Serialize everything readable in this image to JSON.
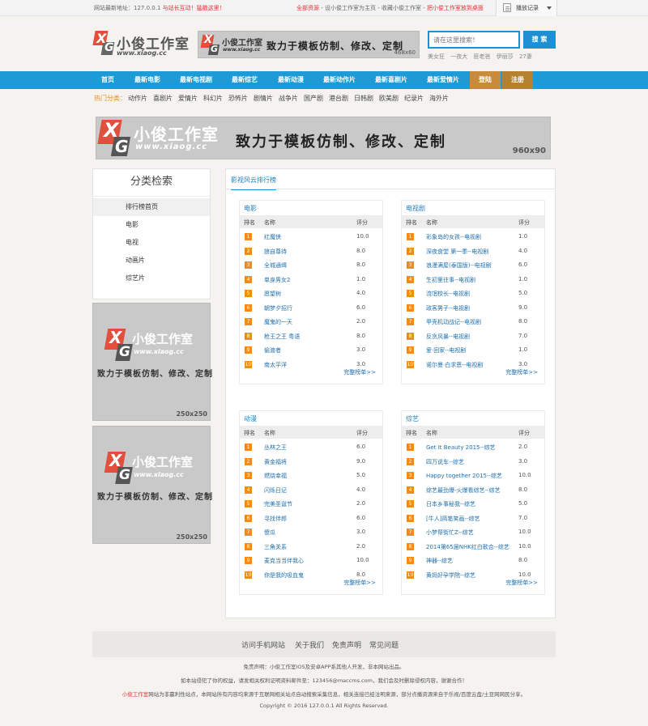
{
  "topbar": {
    "site_addr_label": "网站最新地址：127.0.0.1",
    "site_addr_note": " 与站长互动！猛戳这里！",
    "all_resources": "全部资源",
    "set_home": " - 设小俊工作室为主页 - 收藏小俊工作室 - ",
    "desktop_link": "把小俊工作室放到桌面",
    "history_label": "播放记录"
  },
  "header": {
    "logo_name": "小俊工作室",
    "logo_url": "www.xiaog.cc",
    "banner_name": "小俊工作室",
    "banner_url": "www.xiaog.cc",
    "banner_slogan": "致力于模板仿制、修改、定制",
    "banner_size": "468x60",
    "search_placeholder": "请在这里搜索！",
    "search_button": "搜 索",
    "hot_words": [
      "美女狂",
      "一夜大",
      "匪老爸",
      "伊丽莎",
      "27妻"
    ]
  },
  "nav": {
    "items": [
      "首页",
      "最新电影",
      "最新电视剧",
      "最新综艺",
      "最新动漫",
      "最新动作片",
      "最新喜剧片",
      "最新爱情片"
    ],
    "login": "登陆",
    "register": "注册"
  },
  "categories": {
    "label": "热门分类：",
    "items": [
      "动作片",
      "喜剧片",
      "爱情片",
      "科幻片",
      "恐怖片",
      "剧情片",
      "战争片",
      "国产剧",
      "港台剧",
      "日韩剧",
      "欧美剧",
      "纪录片",
      "海外片"
    ]
  },
  "big_banner": {
    "name": "小俊工作室",
    "url": "www.xiaog.cc",
    "slogan": "致力于模板仿制、修改、定制",
    "size": "960x90"
  },
  "sidebar": {
    "title": "分类检索",
    "items": [
      "排行榜首页",
      "电影",
      "电视",
      "动画片",
      "综艺片"
    ],
    "ad_name": "小俊工作室",
    "ad_url": "www.xiaog.cc",
    "ad_slogan": "致力于模板仿制、修改、定制",
    "ad_size": "250x250"
  },
  "main": {
    "tab": "影视风云排行榜",
    "col_rank": "排名",
    "col_name": "名称",
    "col_score": "评分",
    "more": "完整榜单>>",
    "movie": {
      "title": "电影",
      "rows": [
        {
          "name": "红魔侠",
          "score": "10.0"
        },
        {
          "name": "狼自尊待",
          "score": "8.0"
        },
        {
          "name": "全城通缉",
          "score": "8.0"
        },
        {
          "name": "单身男女2",
          "score": "1.0"
        },
        {
          "name": "愿望树",
          "score": "4.0"
        },
        {
          "name": "朝梦夕招行",
          "score": "6.0"
        },
        {
          "name": "魔鬼的一天",
          "score": "2.0"
        },
        {
          "name": "枪王之王 粤语",
          "score": "8.0"
        },
        {
          "name": "偷渡者",
          "score": "3.0"
        },
        {
          "name": "南太平洋",
          "score": "3.0"
        }
      ]
    },
    "tv": {
      "title": "电视剧",
      "rows": [
        {
          "name": "彩象岛的女孩--电视剧",
          "score": "1.0"
        },
        {
          "name": "深夜食堂 第一季--电视剧",
          "score": "4.0"
        },
        {
          "name": "浪漫满屋(泰国版)--电视剧",
          "score": "6.0"
        },
        {
          "name": "生初里往事--电视剧",
          "score": "1.0"
        },
        {
          "name": "流氓校长--电视剧",
          "score": "5.0"
        },
        {
          "name": "政客男子--电视剧",
          "score": "9.0"
        },
        {
          "name": "甲壳机动战记--电视剧",
          "score": "8.0"
        },
        {
          "name": "反贪风暴--电视剧",
          "score": "7.0"
        },
        {
          "name": "爱·回家--电视剧",
          "score": "1.0"
        },
        {
          "name": "诺尔曼·白求恩--电视剧",
          "score": "3.0"
        }
      ]
    },
    "anime": {
      "title": "动漫",
      "rows": [
        {
          "name": "丛林之王",
          "score": "6.0"
        },
        {
          "name": "黄金福将",
          "score": "9.0"
        },
        {
          "name": "燃烧幸福",
          "score": "5.0"
        },
        {
          "name": "闪烁日记",
          "score": "4.0"
        },
        {
          "name": "完美圣诞节",
          "score": "2.0"
        },
        {
          "name": "寻找伴郎",
          "score": "6.0"
        },
        {
          "name": "傻瓜",
          "score": "3.0"
        },
        {
          "name": "三角关系",
          "score": "2.0"
        },
        {
          "name": "麦克当当伴我心",
          "score": "10.0"
        },
        {
          "name": "你是我的吸血鬼",
          "score": "8.0"
        }
      ]
    },
    "variety": {
      "title": "综艺",
      "rows": [
        {
          "name": "Get It Beauty 2015--综艺",
          "score": "2.0"
        },
        {
          "name": "四万说车--综艺",
          "score": "3.0"
        },
        {
          "name": "Happy together 2015--综艺",
          "score": "10.0"
        },
        {
          "name": "综艺最劲爆-火爆看综艺--综艺",
          "score": "8.0"
        },
        {
          "name": "日本乡事秘我--综艺",
          "score": "5.0"
        },
        {
          "name": "[牛人]简笔笑画--综艺",
          "score": "7.0"
        },
        {
          "name": "小梦帮街忙Z--综艺",
          "score": "10.0"
        },
        {
          "name": "2014第65届NHK红白歌合--综艺",
          "score": "10.0"
        },
        {
          "name": "神器--综艺",
          "score": "8.0"
        },
        {
          "name": "黄妈好孕学院--综艺",
          "score": "10.0"
        }
      ]
    }
  },
  "footer": {
    "links": [
      "访问手机网站",
      "关于我们",
      "免责声明",
      "常见问题"
    ],
    "line1": "免责声明：小俊工作室IOS及安卓APP系其他人开发，非本网站出品。",
    "line2": "如本站侵犯了你的权益，请发相关权利证明资料邮件至：123456@maccms.com，我们会及时删除侵权内容，谢谢合作！",
    "line3_red": "小俊工作室",
    "line3": "网站为非赢利性站点，本网站所有内容均来源于互联网相关站点自动搜索采集信息，相关连接已经注明来源，部分点播资源来自于乐视/百度云盘/土豆网网民分享。",
    "copyright": "Copyright © 2016 127.0.0.1 All Rights Reserved."
  },
  "colors": {
    "nav_blue": "#1e9ad6",
    "accent_orange": "#f08b1c",
    "login_brown": "#c88a3c",
    "link_blue": "#1e6fb0",
    "red": "#dd3333"
  }
}
